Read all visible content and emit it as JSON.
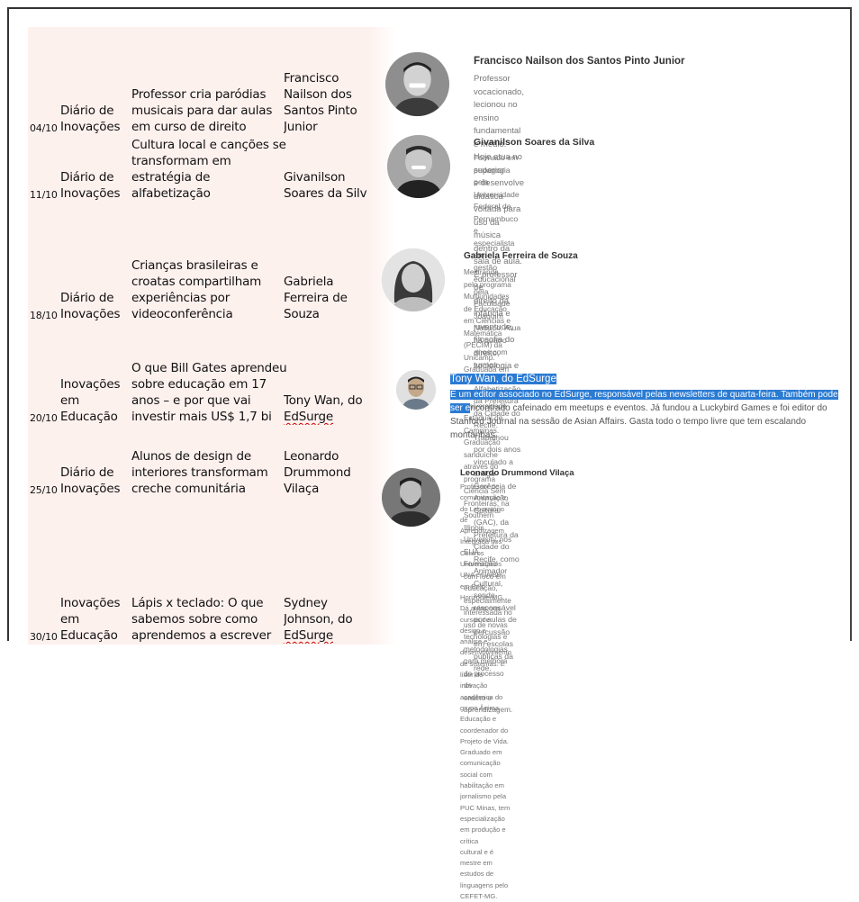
{
  "rows": [
    {
      "date": "04/10",
      "column": [
        "Diário de",
        "Inovações"
      ],
      "title": [
        "Professor cria paródias",
        "musicais para dar aulas",
        "em curso de direito"
      ],
      "author": [
        "Francisco",
        "Nailson dos",
        "Santos Pinto",
        "Junior"
      ]
    },
    {
      "date": "11/10",
      "column": [
        "Diário de",
        "Inovações"
      ],
      "title": [
        "Cultura local e canções se",
        "transformam em",
        "estratégia de",
        "alfabetização"
      ],
      "author": [
        "Givanilson",
        "Soares da Silv"
      ]
    },
    {
      "date": "18/10",
      "column": [
        "Diário de",
        "Inovações"
      ],
      "title": [
        "Crianças brasileiras e",
        "croatas compartilham",
        "experiências por",
        "videoconferência"
      ],
      "author": [
        "Gabriela",
        "Ferreira de",
        "Souza"
      ]
    },
    {
      "date": "20/10",
      "column": [
        "Inovações",
        "em",
        "Educação"
      ],
      "title": [
        "O que Bill Gates aprendeu",
        "sobre educação em 17",
        "anos – e por que vai",
        "investir mais US$ 1,7 bi"
      ],
      "author": [
        "Tony Wan, do",
        "EdSurge"
      ]
    },
    {
      "date": "25/10",
      "column": [
        "Diário de",
        "Inovações"
      ],
      "title": [
        "Alunos de design de",
        "interiores transformam",
        "creche comunitária"
      ],
      "author": [
        "Leonardo",
        "Drummond",
        "Vilaça"
      ]
    },
    {
      "date": "30/10",
      "column": [
        "Inovações",
        "em",
        "Educação"
      ],
      "title": [
        "Lápis x teclado: O que",
        "sabemos sobre como",
        "aprendemos a escrever"
      ],
      "author": [
        "Sydney",
        "Johnson, do",
        "EdSurge"
      ]
    }
  ],
  "profiles": [
    {
      "name": "Francisco Nailson dos Santos Pinto Junior",
      "bio": [
        "Professor vocacionado, lecionou no ensino fundamental e médio. Hoje atua no superior",
        "e desenvolve didática voltada para uso da música dentro da sala de aula. É professor de",
        "direito da infância e juventude, filosofia do direito, sociologia e mediação."
      ]
    },
    {
      "name": "Givanilson Soares da Silva",
      "bio": [
        "Formado em pedagogia pela Universidade Federal de Pernambuco e especialista em",
        "gestão educacional pela Faculdade Joaquim Nabuco. Atua há quatro anos com turmas",
        "do Ciclo de Alfabetização da Prefeitura da Cidade do Recife. Trabalhou por dois anos",
        "vinculado a antiga Gerência de Animação Cultural (GAC), da Prefeitura da Cidade do",
        "Recife, como Animador Cultural, sendo responsável por aulas de percussão em escolas",
        "públicas da rede."
      ]
    },
    {
      "name": "Gabriela Ferreira de Souza",
      "bio": [
        "Mestranda pelo programa Multiunidades de Educação em Ciências e Matemática",
        "(PECIM) da Unicamp. Graduada em ciências biológicas pela Universidade Estadual de",
        "Campinas. Graduação sanduíche através do programa Ciência Sem Fronteiras, na",
        "Southern Illinois University, nos EUA. Formação com foco em educação, especialmente",
        "interessada no uso de novas tecnologias e metodologias para melhora do processo de",
        "ensino e aprendizagem."
      ]
    },
    {
      "name": "Tony Wan, do EdSurge",
      "bio_highlight": "É um editor associado no EdSurge, responsável pelas newsletters de quarta-feira. Também pode",
      "bio_highlight2": "ser e",
      "bio_rest": "ncontrado cafeinado em meetups e eventos. Já fundou a Luckybird Games e foi editor do",
      "bio": [
        "Stanford Journal na sessão de Asian Affairs. Gasta todo o tempo livre que tem escalando",
        "montanhas."
      ]
    },
    {
      "name": "Leonardo Drummond Vilaça",
      "bio": [
        "Professor de comunicação e do Laboratório de Aprendizagem Integrada nos Centros",
        "Universitários UNA e UniBH, em Belo Horizonte-MG. Dá aulas nos cursos de design e",
        "análise e desenvolvimento de sistemas. É líder de inovação acadêmica do grupo Ânima",
        "Educação e coordenador do Projeto de Vida. Graduado em comunicação social com",
        "habilitação em jornalismo pela PUC Minas, tem especialização em produção e crítica",
        "cultural e é mestre em estudos de linguagens pelo CEFET-MG."
      ]
    }
  ]
}
